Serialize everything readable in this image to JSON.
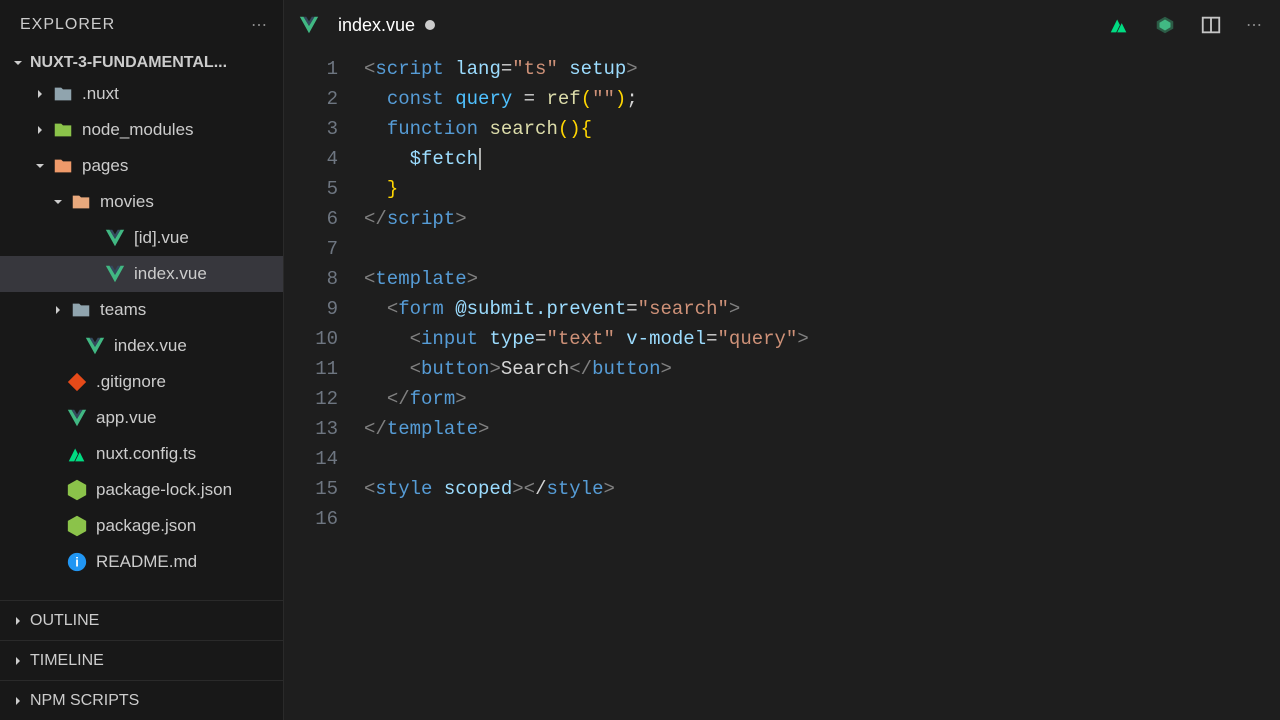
{
  "sidebar": {
    "title": "EXPLORER",
    "project": "NUXT-3-FUNDAMENTAL...",
    "tree": [
      {
        "name": ".nuxt",
        "indent": 32,
        "type": "folder-dark",
        "chev": "right"
      },
      {
        "name": "node_modules",
        "indent": 32,
        "type": "folder-green",
        "chev": "right"
      },
      {
        "name": "pages",
        "indent": 32,
        "type": "folder-pages",
        "chev": "down"
      },
      {
        "name": "movies",
        "indent": 50,
        "type": "folder-movies",
        "chev": "down"
      },
      {
        "name": "[id].vue",
        "indent": 88,
        "type": "vue"
      },
      {
        "name": "index.vue",
        "indent": 88,
        "type": "vue",
        "active": true
      },
      {
        "name": "teams",
        "indent": 50,
        "type": "folder-dark",
        "chev": "right"
      },
      {
        "name": "index.vue",
        "indent": 68,
        "type": "vue"
      },
      {
        "name": ".gitignore",
        "indent": 50,
        "type": "git"
      },
      {
        "name": "app.vue",
        "indent": 50,
        "type": "vue"
      },
      {
        "name": "nuxt.config.ts",
        "indent": 50,
        "type": "nuxt"
      },
      {
        "name": "package-lock.json",
        "indent": 50,
        "type": "node"
      },
      {
        "name": "package.json",
        "indent": 50,
        "type": "node"
      },
      {
        "name": "README.md",
        "indent": 50,
        "type": "info"
      }
    ],
    "panels": [
      "OUTLINE",
      "TIMELINE",
      "NPM SCRIPTS"
    ]
  },
  "tab": {
    "filename": "index.vue"
  },
  "code": {
    "lines": 16,
    "content": [
      [
        [
          "c-gray",
          "<"
        ],
        [
          "c-tag",
          "script"
        ],
        [
          " "
        ],
        [
          "c-attr",
          "lang"
        ],
        [
          "c-punct",
          "="
        ],
        [
          "c-str",
          "\"ts\""
        ],
        [
          " "
        ],
        [
          "c-attr",
          "setup"
        ],
        [
          "c-gray",
          ">"
        ]
      ],
      [
        [
          "  "
        ],
        [
          "c-kw",
          "const"
        ],
        [
          " "
        ],
        [
          "c-const",
          "query"
        ],
        [
          " "
        ],
        [
          "c-punct",
          "="
        ],
        [
          " "
        ],
        [
          "c-fn",
          "ref"
        ],
        [
          "c-yellow",
          "("
        ],
        [
          "c-str",
          "\"\""
        ],
        [
          "c-yellow",
          ")"
        ],
        [
          "c-punct",
          ";"
        ]
      ],
      [
        [
          "  "
        ],
        [
          "c-kw",
          "function"
        ],
        [
          " "
        ],
        [
          "c-fn",
          "search"
        ],
        [
          "c-yellow",
          "()"
        ],
        [
          "c-yellow",
          "{"
        ]
      ],
      [
        [
          "    "
        ],
        [
          "c-var",
          "$fetch"
        ],
        [
          "cursor"
        ]
      ],
      [
        [
          "  "
        ],
        [
          "c-yellow",
          "}"
        ]
      ],
      [
        [
          "c-gray",
          "</"
        ],
        [
          "c-tag",
          "script"
        ],
        [
          "c-gray",
          ">"
        ]
      ],
      [],
      [
        [
          "c-gray",
          "<"
        ],
        [
          "c-tag",
          "template"
        ],
        [
          "c-gray",
          ">"
        ]
      ],
      [
        [
          "  "
        ],
        [
          "c-gray",
          "<"
        ],
        [
          "c-tag",
          "form"
        ],
        [
          " "
        ],
        [
          "c-attr",
          "@submit.prevent"
        ],
        [
          "c-punct",
          "="
        ],
        [
          "c-str",
          "\"search\""
        ],
        [
          "c-gray",
          ">"
        ]
      ],
      [
        [
          "    "
        ],
        [
          "c-gray",
          "<"
        ],
        [
          "c-tag",
          "input"
        ],
        [
          " "
        ],
        [
          "c-attr",
          "type"
        ],
        [
          "c-punct",
          "="
        ],
        [
          "c-str",
          "\"text\""
        ],
        [
          " "
        ],
        [
          "c-attr",
          "v-model"
        ],
        [
          "c-punct",
          "="
        ],
        [
          "c-str",
          "\"query\""
        ],
        [
          "c-gray",
          ">"
        ]
      ],
      [
        [
          "    "
        ],
        [
          "c-gray",
          "<"
        ],
        [
          "c-tag",
          "button"
        ],
        [
          "c-gray",
          ">"
        ],
        [
          "c-punct",
          "Search"
        ],
        [
          "c-gray",
          "</"
        ],
        [
          "c-tag",
          "button"
        ],
        [
          "c-gray",
          ">"
        ]
      ],
      [
        [
          "  "
        ],
        [
          "c-gray",
          "</"
        ],
        [
          "c-tag",
          "form"
        ],
        [
          "c-gray",
          ">"
        ]
      ],
      [
        [
          "c-gray",
          "</"
        ],
        [
          "c-tag",
          "template"
        ],
        [
          "c-gray",
          ">"
        ]
      ],
      [],
      [
        [
          "c-gray",
          "<"
        ],
        [
          "c-tag",
          "style"
        ],
        [
          " "
        ],
        [
          "c-attr",
          "scoped"
        ],
        [
          "c-gray",
          "><"
        ],
        [
          "c-punct",
          "/"
        ],
        [
          "c-tag",
          "style"
        ],
        [
          "c-gray",
          ">"
        ]
      ],
      []
    ]
  }
}
